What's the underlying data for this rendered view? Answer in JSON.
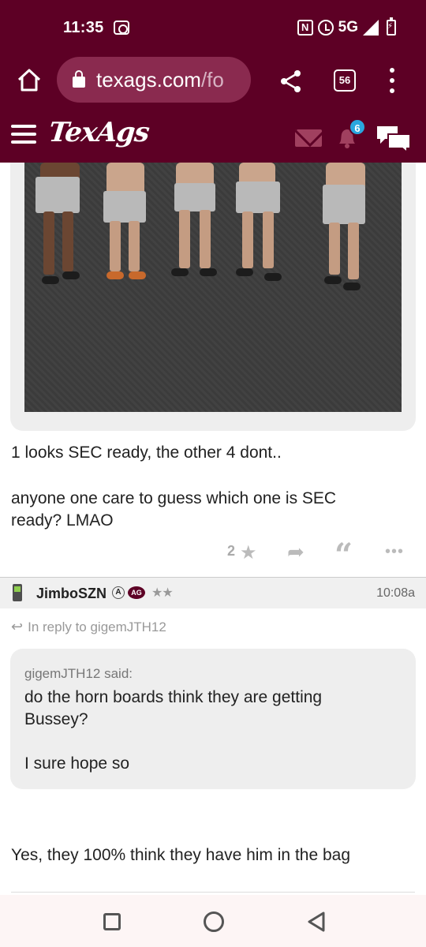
{
  "status_bar": {
    "time": "11:35",
    "network": "5G"
  },
  "browser": {
    "url_main": "texags.com",
    "url_path": "/fo",
    "tab_count": "56"
  },
  "site": {
    "logo": "TexAgs",
    "notification_count": "6"
  },
  "post1": {
    "line1": "1 looks SEC ready, the other 4 dont..",
    "line2": "anyone one care to guess which one is SEC",
    "line3": "ready? LMAO",
    "likes": "2"
  },
  "post2": {
    "username": "JimboSZN",
    "badge_a": "A",
    "badge_ag": "AG",
    "stars": "★★",
    "time": "10:08a",
    "reply_to": "In reply to gigemJTH12",
    "quote": {
      "author": "gigemJTH12 said:",
      "line1": "do the horn boards think they are getting",
      "line2": "Bussey?",
      "line3": "I sure hope so"
    },
    "body": "Yes, they 100% think they have him in the bag"
  },
  "colors": {
    "brand": "#5d0025",
    "badge": "#2aa7df"
  }
}
